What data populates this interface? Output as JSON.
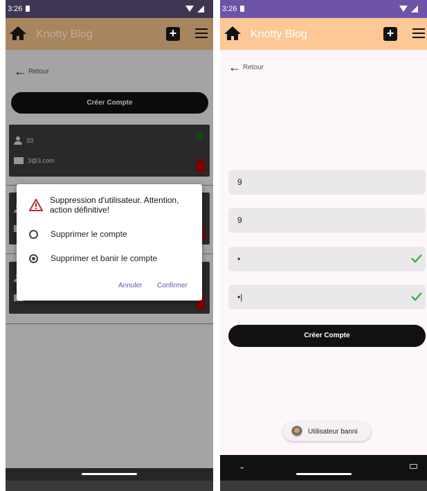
{
  "left": {
    "status": {
      "time": "3:26"
    },
    "appbar": {
      "title": "Knotty Blog"
    },
    "back_label": "Retour",
    "create_button": "Créer Compte",
    "users": [
      {
        "name": "33",
        "email": "3@3.com"
      },
      {
        "name": "",
        "email": ""
      },
      {
        "name": "",
        "email": ""
      }
    ],
    "dialog": {
      "title": "Suppression d'utilisateur. Attention, action définitive!",
      "options": [
        {
          "label": "Supprimer le compte",
          "selected": false
        },
        {
          "label": "Supprimer et banir le compte",
          "selected": true
        }
      ],
      "cancel": "Annuler",
      "confirm": "Confirmer"
    }
  },
  "right": {
    "status": {
      "time": "3:26"
    },
    "appbar": {
      "title": "Knotty Blog"
    },
    "back_label": "Retour",
    "fields": [
      {
        "value": "9",
        "valid": false
      },
      {
        "value": "9",
        "valid": false
      },
      {
        "value": "•",
        "valid": true
      },
      {
        "value": "•|",
        "valid": true
      }
    ],
    "create_button": "Créer Compte",
    "toast": "Utilisateur banni"
  },
  "colors": {
    "accent": "#6a4fb0",
    "appbar": "#fdc895",
    "statusbar": "#6e54a8",
    "valid_check": "#35b33a",
    "delete_red": "#b80000"
  }
}
